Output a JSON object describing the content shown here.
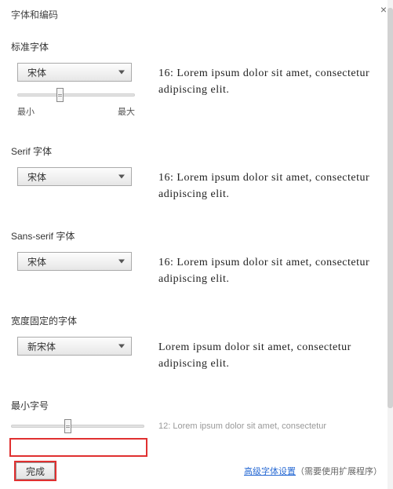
{
  "title": "字体和编码",
  "close_label": "×",
  "sections": {
    "standard": {
      "label": "标准字体",
      "select_value": "宋体",
      "slider": {
        "min_label": "最小",
        "max_label": "最大",
        "thumb_percent": 33
      },
      "preview": "16: Lorem ipsum dolor sit amet, consectetur adipiscing elit."
    },
    "serif": {
      "label": "Serif 字体",
      "select_value": "宋体",
      "preview": "16: Lorem ipsum dolor sit amet, consectetur adipiscing elit."
    },
    "sans": {
      "label": "Sans-serif 字体",
      "select_value": "宋体",
      "preview": "16: Lorem ipsum dolor sit amet, consectetur adipiscing elit."
    },
    "fixed": {
      "label": "宽度固定的字体",
      "select_value": "新宋体",
      "preview": "Lorem ipsum dolor sit amet, consectetur adipiscing elit."
    },
    "minsize": {
      "label": "最小字号",
      "slider": {
        "thumb_percent": 40
      },
      "preview": "12: Lorem ipsum dolor sit amet, consectetur"
    }
  },
  "footer": {
    "done_label": "完成",
    "link_label": "高级字体设置",
    "note_label": "（需要使用扩展程序）"
  }
}
